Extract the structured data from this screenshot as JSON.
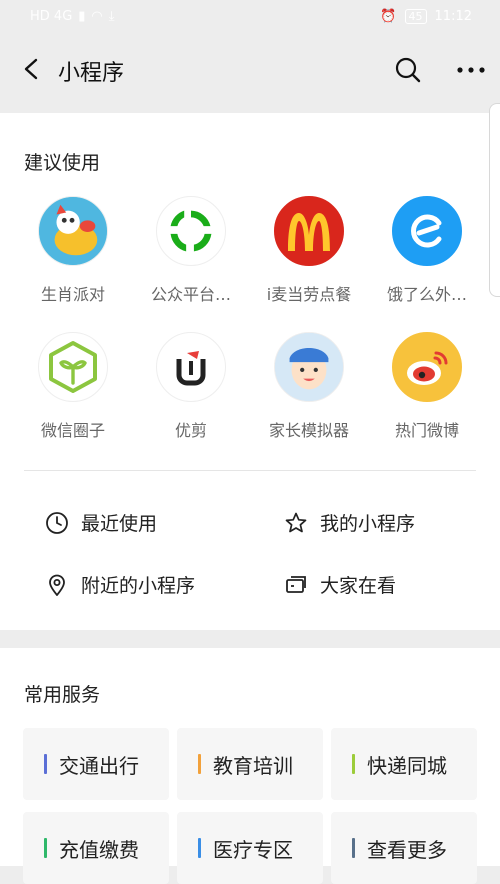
{
  "status_bar": {
    "network": "HD 4G",
    "battery": "45",
    "time": "11:12"
  },
  "nav": {
    "title": "小程序"
  },
  "suggested": {
    "title": "建议使用",
    "apps": [
      {
        "label": "生肖派对",
        "icon": "zodiac-party-icon"
      },
      {
        "label": "公众平台…",
        "icon": "public-platform-icon"
      },
      {
        "label": "i麦当劳点餐",
        "icon": "mcdonalds-icon"
      },
      {
        "label": "饿了么外…",
        "icon": "eleme-icon"
      },
      {
        "label": "微信圈子",
        "icon": "wechat-circle-icon"
      },
      {
        "label": "优剪",
        "icon": "youjian-icon"
      },
      {
        "label": "家长模拟器",
        "icon": "parent-simulator-icon"
      },
      {
        "label": "热门微博",
        "icon": "weibo-icon"
      }
    ]
  },
  "quick_links": [
    {
      "label": "最近使用",
      "icon": "clock-icon"
    },
    {
      "label": "我的小程序",
      "icon": "star-icon"
    },
    {
      "label": "附近的小程序",
      "icon": "location-pin-icon"
    },
    {
      "label": "大家在看",
      "icon": "watching-icon"
    }
  ],
  "services": {
    "title": "常用服务",
    "items": [
      {
        "label": "交通出行",
        "color": "#5b6fd6"
      },
      {
        "label": "教育培训",
        "color": "#f2a13b"
      },
      {
        "label": "快递同城",
        "color": "#9ccc3a"
      },
      {
        "label": "充值缴费",
        "color": "#2fb86a"
      },
      {
        "label": "医疗专区",
        "color": "#3a8ee6"
      },
      {
        "label": "查看更多",
        "color": "#58708a"
      }
    ]
  }
}
